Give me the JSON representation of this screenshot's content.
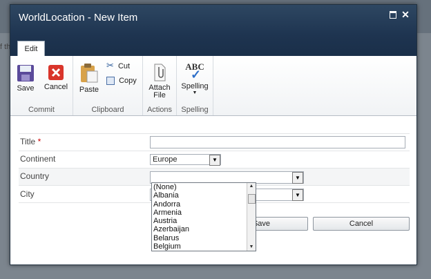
{
  "background": {
    "clipped_text": "f th"
  },
  "dialog": {
    "title": "WorldLocation - New Item",
    "maximize_icon": "maximize-icon",
    "close_icon": "close-icon",
    "tab": "Edit"
  },
  "ribbon": {
    "commit": {
      "label": "Commit",
      "save": "Save",
      "cancel": "Cancel"
    },
    "clipboard": {
      "label": "Clipboard",
      "paste": "Paste",
      "cut": "Cut",
      "copy": "Copy"
    },
    "actions": {
      "label": "Actions",
      "attach_line1": "Attach",
      "attach_line2": "File"
    },
    "spelling": {
      "label": "Spelling",
      "button": "Spelling",
      "abc": "ABC"
    }
  },
  "form": {
    "title_label": "Title",
    "required_mark": "*",
    "title_value": "",
    "continent_label": "Continent",
    "continent_value": "Europe",
    "country_label": "Country",
    "country_value": "",
    "city_label": "City",
    "city_value": ""
  },
  "country_options": [
    "(None)",
    "Albania",
    "Andorra",
    "Armenia",
    "Austria",
    "Azerbaijan",
    "Belarus",
    "Belgium"
  ],
  "buttons": {
    "save": "Save",
    "cancel": "Cancel"
  }
}
